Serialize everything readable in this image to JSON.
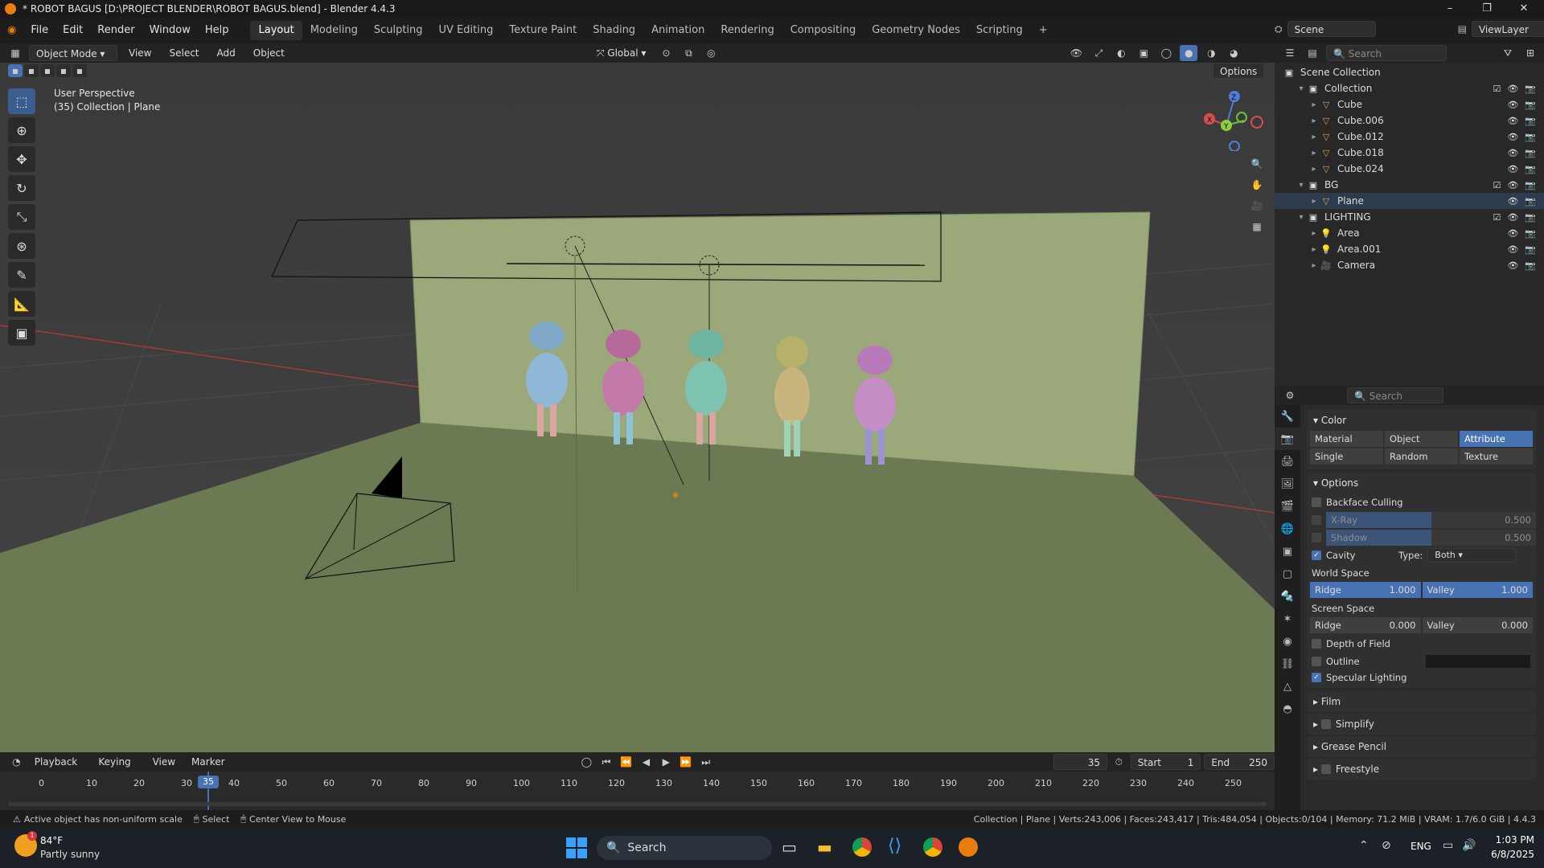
{
  "app": {
    "title": "* ROBOT BAGUS [D:\\PROJECT BLENDER\\ROBOT BAGUS.blend] - Blender 4.4.3"
  },
  "menu": [
    "File",
    "Edit",
    "Render",
    "Window",
    "Help"
  ],
  "workspaces": [
    "Layout",
    "Modeling",
    "Sculpting",
    "UV Editing",
    "Texture Paint",
    "Shading",
    "Animation",
    "Rendering",
    "Compositing",
    "Geometry Nodes",
    "Scripting"
  ],
  "scene": {
    "name": "Scene",
    "view_layer": "ViewLayer"
  },
  "header3d": {
    "mode": "Object Mode",
    "view": "View",
    "select": "Select",
    "add": "Add",
    "object": "Object",
    "transform": "Global",
    "options": "Options"
  },
  "viewport": {
    "line1": "User Perspective",
    "line2": "(35) Collection | Plane"
  },
  "gizmo": {
    "x": "X",
    "y": "Y",
    "z": "Z"
  },
  "outliner": {
    "search_placeholder": "Search",
    "root": "Scene Collection",
    "rows": [
      {
        "label": "Collection",
        "indent": 1,
        "type": "collection"
      },
      {
        "label": "Cube",
        "indent": 2,
        "type": "mesh"
      },
      {
        "label": "Cube.006",
        "indent": 2,
        "type": "mesh"
      },
      {
        "label": "Cube.012",
        "indent": 2,
        "type": "mesh"
      },
      {
        "label": "Cube.018",
        "indent": 2,
        "type": "mesh"
      },
      {
        "label": "Cube.024",
        "indent": 2,
        "type": "mesh"
      },
      {
        "label": "BG",
        "indent": 1,
        "type": "collection"
      },
      {
        "label": "Plane",
        "indent": 2,
        "type": "mesh"
      },
      {
        "label": "LIGHTING",
        "indent": 1,
        "type": "collection"
      },
      {
        "label": "Area",
        "indent": 2,
        "type": "light"
      },
      {
        "label": "Area.001",
        "indent": 2,
        "type": "light"
      },
      {
        "label": "Camera",
        "indent": 2,
        "type": "camera"
      }
    ]
  },
  "props": {
    "search_placeholder": "Search",
    "color": {
      "title": "Color",
      "row1": [
        "Material",
        "Object",
        "Attribute"
      ],
      "row2": [
        "Single",
        "Random",
        "Texture"
      ],
      "active": "Attribute"
    },
    "options": {
      "title": "Options",
      "backface": "Backface Culling",
      "xray": "X-Ray",
      "xray_val": "0.500",
      "shadow": "Shadow",
      "shadow_val": "0.500",
      "cavity": "Cavity",
      "type_label": "Type:",
      "type_val": "Both",
      "world_space": "World Space",
      "ridge": "Ridge",
      "ridge_ws": "1.000",
      "valley": "Valley",
      "valley_ws": "1.000",
      "screen_space": "Screen Space",
      "ridge_ss": "0.000",
      "valley_ss": "0.000",
      "dof": "Depth of Field",
      "outline": "Outline",
      "specular": "Specular Lighting"
    },
    "sections": [
      "Film",
      "Simplify",
      "Grease Pencil",
      "Freestyle"
    ]
  },
  "timeline": {
    "playback": "Playback",
    "keying": "Keying",
    "view": "View",
    "marker": "Marker",
    "current": "35",
    "start_label": "Start",
    "start": "1",
    "end_label": "End",
    "end": "250",
    "ticks": [
      "0",
      "10",
      "20",
      "30",
      "35",
      "40",
      "50",
      "60",
      "70",
      "80",
      "90",
      "100",
      "110",
      "120",
      "130",
      "140",
      "150",
      "160",
      "170",
      "180",
      "190",
      "200",
      "210",
      "220",
      "230",
      "240",
      "250"
    ]
  },
  "status": {
    "warning": "Active object has non-uniform scale",
    "select": "Select",
    "center": "Center View to Mouse",
    "stats": "Collection | Plane | Verts:243,006 | Faces:243,417 | Tris:484,054 | Objects:0/104 | Memory: 71.2 MiB | VRAM: 1.7/6.0 GiB | 4.4.3"
  },
  "taskbar": {
    "temp": "84°F",
    "weather": "Partly sunny",
    "search": "Search",
    "lang": "ENG",
    "time": "1:03 PM",
    "date": "6/8/2025",
    "badge": "1"
  },
  "colors": {
    "accent": "#4772b3",
    "viewport_bg": "#3d3d3d",
    "backdrop": "#9aa87a",
    "floor": "#6b7a52"
  }
}
